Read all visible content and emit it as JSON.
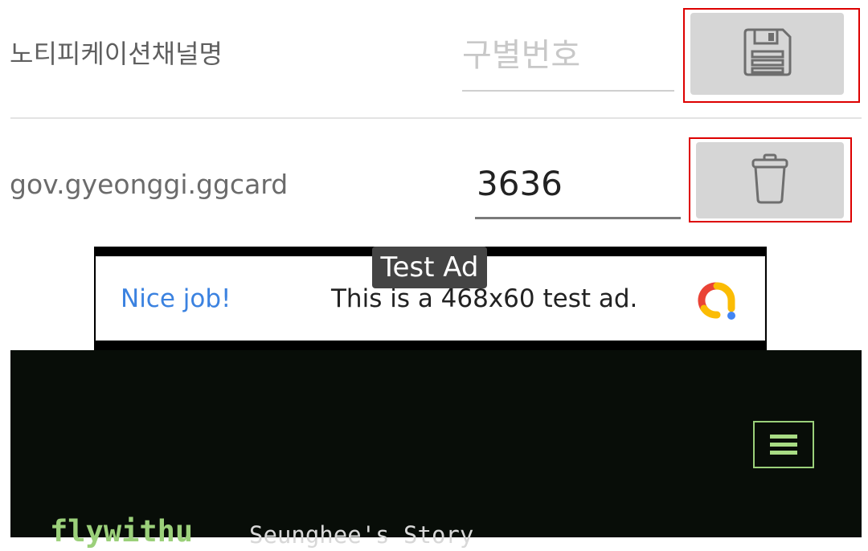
{
  "row1": {
    "channel_label": "노티피케이션채널명",
    "id_placeholder": "구별번호",
    "save_icon": "floppy-disk-icon"
  },
  "row2": {
    "package_name": "gov.gyeonggi.ggcard",
    "id_value": "3636",
    "delete_icon": "trash-can-icon"
  },
  "ad": {
    "badge": "Test Ad",
    "headline": "Nice job!",
    "body": "This is a 468x60 test ad.",
    "logo": "admob-logo-icon"
  },
  "website": {
    "title": "flywithu",
    "tagline": "Seunghee's Story",
    "menu_icon": "hamburger-menu-icon",
    "accent_color": "#9bd07a",
    "background_color": "#080d08"
  },
  "colors": {
    "highlight": "#dd0000",
    "button_bg": "#d6d6d6"
  }
}
